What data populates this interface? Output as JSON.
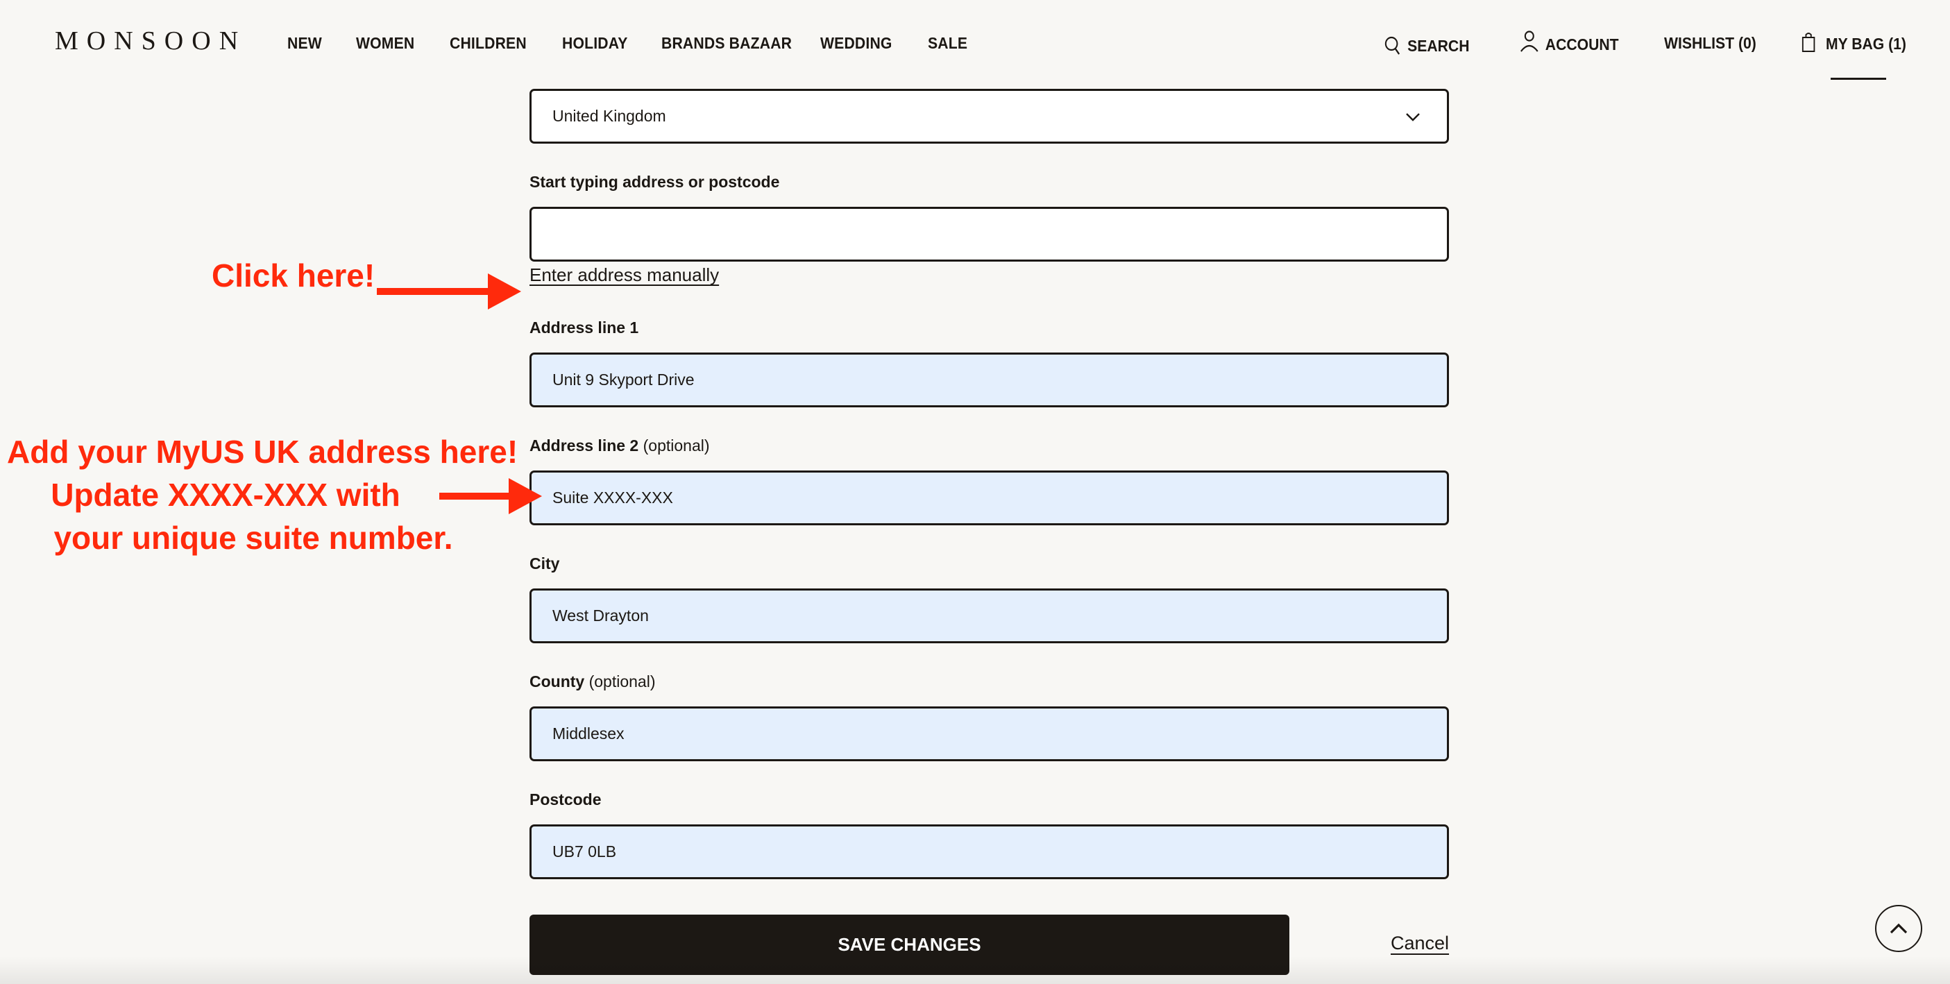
{
  "header": {
    "logo": "MONSOON",
    "nav": [
      {
        "label": "NEW"
      },
      {
        "label": "WOMEN"
      },
      {
        "label": "CHILDREN"
      },
      {
        "label": "HOLIDAY"
      },
      {
        "label": "BRANDS BAZAAR"
      },
      {
        "label": "WEDDING"
      },
      {
        "label": "SALE"
      }
    ],
    "utility": {
      "search": {
        "label": "SEARCH",
        "icon": "search-icon"
      },
      "account": {
        "label": "ACCOUNT",
        "icon": "user-icon"
      },
      "wishlist": {
        "label": "WISHLIST (0)"
      },
      "bag": {
        "label": "MY BAG (1)",
        "icon": "shopping-bag-icon"
      }
    }
  },
  "form": {
    "country": {
      "value": "United Kingdom",
      "icon": "chevron-down-icon"
    },
    "address_lookup": {
      "label": "Start typing address or postcode",
      "value": ""
    },
    "manual_link": "Enter address manually",
    "address_line_1": {
      "label": "Address line 1",
      "value": "Unit 9 Skyport Drive"
    },
    "address_line_2": {
      "label": "Address line 2",
      "optional": "(optional)",
      "value": "Suite XXXX-XXX"
    },
    "city": {
      "label": "City",
      "value": "West Drayton"
    },
    "county": {
      "label": "County",
      "optional": "(optional)",
      "value": "Middlesex"
    },
    "postcode": {
      "label": "Postcode",
      "value": "UB7 0LB"
    },
    "save_label": "SAVE CHANGES",
    "cancel_label": "Cancel"
  },
  "scroll_top": {
    "icon": "chevron-up-icon"
  },
  "annotations": {
    "click_here": "Click here!",
    "address_note": [
      "Add your MyUS UK address here!",
      "Update XXXX-XXX with",
      "your unique suite number."
    ],
    "color": "#ff2a0c"
  },
  "colors": {
    "background": "#f8f7f4",
    "text": "#1c1814",
    "autofill": "#e4effd",
    "annotation": "#ff2a0c"
  }
}
